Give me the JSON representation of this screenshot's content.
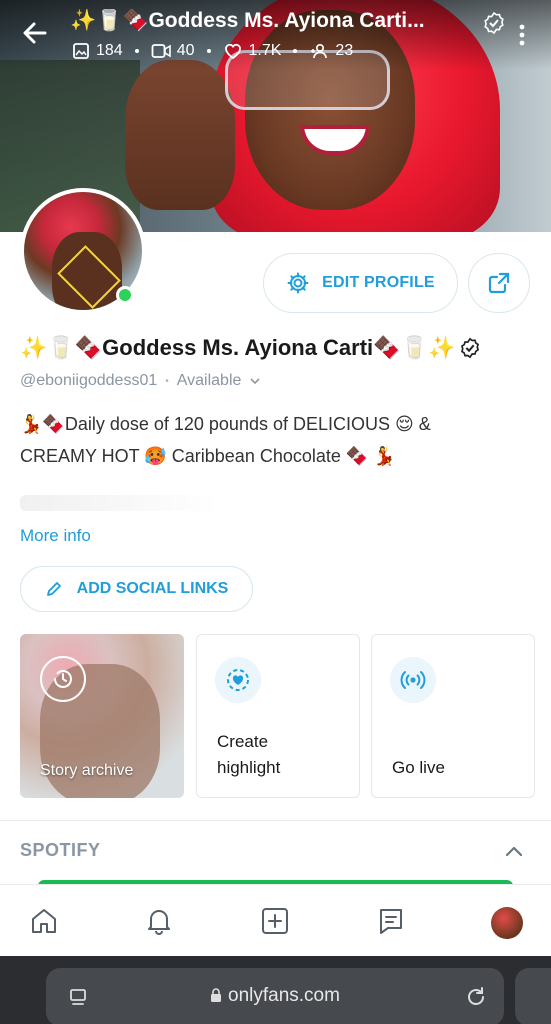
{
  "header": {
    "title": "✨🥛🍫Goddess Ms. Ayiona Carti...",
    "stats": {
      "photos": "184",
      "videos": "40",
      "likes": "1.7K",
      "fans": "23"
    }
  },
  "profile": {
    "name": "✨🥛🍫Goddess Ms. Ayiona Carti🍫🥛✨",
    "handle": "@eboniigoddess01",
    "availability": "Available",
    "bio_line1": "💃🍫Daily dose of 120 pounds of DELICIOUS 😌 &",
    "bio_line2": "CREAMY HOT 🥵 Caribbean Chocolate 🍫 💃",
    "more_info": "More info",
    "edit_profile": "EDIT PROFILE",
    "add_social_links": "ADD SOCIAL LINKS"
  },
  "cards": {
    "story_archive": "Story archive",
    "create_highlight_line1": "Create",
    "create_highlight_line2": "highlight",
    "go_live": "Go live"
  },
  "sections": {
    "spotify": "SPOTIFY"
  },
  "bottom_nav": [
    "home-icon",
    "bell-icon",
    "plus-square-icon",
    "message-icon",
    "avatar"
  ],
  "browser": {
    "url": "onlyfans.com"
  },
  "colors": {
    "accent": "#1f9ed9",
    "online": "#2ed15a",
    "muted": "#8a96a3",
    "spotify": "#1db954"
  }
}
